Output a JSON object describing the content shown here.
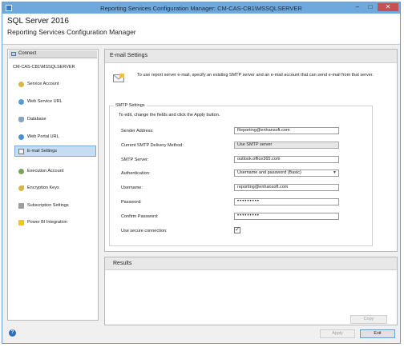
{
  "window": {
    "title": "Reporting Services Configuration Manager: CM-CAS-CB1\\MSSQLSERVER",
    "controls": {
      "minimize": "–",
      "maximize": "□",
      "close": "✕"
    }
  },
  "header": {
    "product": "SQL Server 2016",
    "subtitle": "Reporting Services Configuration Manager"
  },
  "sidebar": {
    "connect_label": "Connect",
    "server": "CM-CAS-CB1\\MSSQLSERVER",
    "items": [
      {
        "label": "Service Account",
        "icon": "service-account-icon",
        "active": false
      },
      {
        "label": "Web Service URL",
        "icon": "web-service-icon",
        "active": false
      },
      {
        "label": "Database",
        "icon": "database-icon",
        "active": false
      },
      {
        "label": "Web Portal URL",
        "icon": "web-portal-icon",
        "active": false
      },
      {
        "label": "E-mail Settings",
        "icon": "email-icon",
        "active": true
      },
      {
        "label": "Execution Account",
        "icon": "execution-account-icon",
        "active": false
      },
      {
        "label": "Encryption Keys",
        "icon": "key-icon",
        "active": false
      },
      {
        "label": "Subscription Settings",
        "icon": "subscription-icon",
        "active": false
      },
      {
        "label": "Power BI Integration",
        "icon": "powerbi-icon",
        "active": false
      }
    ]
  },
  "email": {
    "heading": "E-mail Settings",
    "intro": "To use report server e-mail, specify an existing SMTP server and an e-mail account that can send e-mail from that server.",
    "group_title": "SMTP Settings",
    "hint": "To edit, change the fields and click the Apply button.",
    "fields": {
      "sender_label": "Sender Address:",
      "sender_value": "Reporting@enhansoft.com",
      "method_label": "Current SMTP Delivery Method:",
      "method_value": "Use SMTP server",
      "smtp_label": "SMTP Server:",
      "smtp_value": "outlook.office365.com",
      "auth_label": "Authentication:",
      "auth_value": "Username and password (Basic)",
      "username_label": "Username:",
      "username_value": "reporting@enhansoft.com",
      "password_label": "Password:",
      "password_value": "•••••••••",
      "confirm_label": "Confirm Password:",
      "confirm_value": "•••••••••",
      "secure_label": "Use secure connection:",
      "secure_checked": "✓"
    }
  },
  "results": {
    "heading": "Results",
    "copy_label": "Copy"
  },
  "footer": {
    "help": "?",
    "apply_label": "Apply",
    "exit_label": "Exit"
  },
  "colors": {
    "titlebar": "#6fa8dc",
    "active_item": "#c5dcf2",
    "close_button": "#c75050"
  }
}
